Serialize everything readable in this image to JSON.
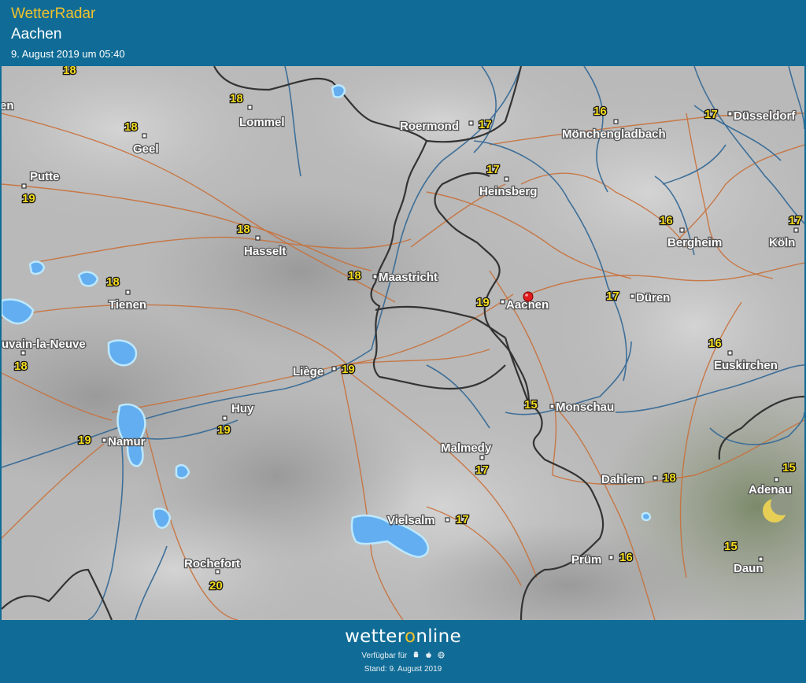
{
  "header": {
    "app_title": "WetterRadar",
    "location": "Aachen",
    "timestamp": "9. August 2019 um 05:40"
  },
  "map": {
    "cities": [
      {
        "name": "Lommel",
        "temp": "18"
      },
      {
        "name": "Roermond",
        "temp": "17"
      },
      {
        "name": "Mönchengladbach",
        "temp": "16"
      },
      {
        "name": "Düsseldorf",
        "temp": "17"
      },
      {
        "name": "Geel",
        "temp": "18"
      },
      {
        "name": "Putte",
        "temp": "19"
      },
      {
        "name": "Heinsberg",
        "temp": "17"
      },
      {
        "name": "Bergheim",
        "temp": "16"
      },
      {
        "name": "Köln",
        "temp": "17"
      },
      {
        "name": "Hasselt",
        "temp": "18"
      },
      {
        "name": "Maastricht",
        "temp": "18"
      },
      {
        "name": "Tienen",
        "temp": "18"
      },
      {
        "name": "Aachen",
        "temp": "19"
      },
      {
        "name": "Düren",
        "temp": "17"
      },
      {
        "name": "uvain-la-Neuve",
        "temp": "18"
      },
      {
        "name": "Euskirchen",
        "temp": "16"
      },
      {
        "name": "Liège",
        "temp": "19"
      },
      {
        "name": "Huy",
        "temp": "19"
      },
      {
        "name": "Monschau",
        "temp": "15"
      },
      {
        "name": "Namur",
        "temp": "19"
      },
      {
        "name": "Malmedy",
        "temp": "17"
      },
      {
        "name": "Dahlem",
        "temp": "18"
      },
      {
        "name": "Adenau",
        "temp": "15"
      },
      {
        "name": "Vielsalm",
        "temp": "17"
      },
      {
        "name": "Prüm",
        "temp": "16"
      },
      {
        "name": "Daun",
        "temp": "15"
      },
      {
        "name": "Rochefort",
        "temp": "20"
      }
    ],
    "edge_text": {
      "top_temp": "18",
      "left_fragment": "en"
    },
    "marker": "location-pin-icon",
    "night_icon": "crescent-moon-icon",
    "colors": {
      "rain": "#62aef0",
      "road": "#c8703a",
      "river": "#3e6f98",
      "border": "#333333",
      "temp": "#f5dc1e"
    }
  },
  "footer": {
    "brand_prefix": "wetter",
    "brand_o": "o",
    "brand_suffix": "nline",
    "available_label": "Verfügbar für",
    "platform_icons": [
      "android-icon",
      "apple-icon",
      "web-icon"
    ],
    "stand": "Stand: 9. August 2019"
  }
}
